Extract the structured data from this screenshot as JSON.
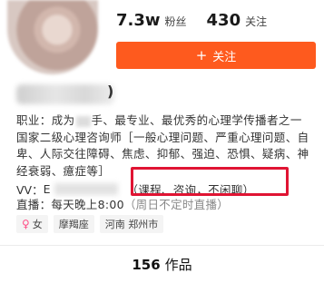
{
  "stats": {
    "fans_count": "7.3w",
    "fans_label": "粉丝",
    "following_count": "430",
    "following_label": "关注"
  },
  "follow_button": {
    "plus": "+",
    "label": "关注"
  },
  "profile": {
    "name_suffix": ")",
    "bio_line1_pre": "职业：成为",
    "bio_line1_post": "手、最专业、最优秀的心理学传播者之一",
    "bio_line2": "国家二级心理咨询师［一般心理问题、严重心理问题、自",
    "bio_line3": "卑、人际交往障碍、焦虑、抑郁、强迫、恐惧、疑病、神",
    "bio_line4": "经衰弱、癔症等］",
    "vv_label": "VV：",
    "vv_prefix": "E",
    "vv_note": "（课程、咨询，不闲聊）",
    "live_label": "直播：每天晚上8:00",
    "live_note": "（周日不定时直播）"
  },
  "tags": {
    "gender_icon": "female-icon",
    "gender": "女",
    "zodiac": "摩羯座",
    "location": "河南 郑州市"
  },
  "works": {
    "count": "156",
    "label": "作品"
  },
  "colors": {
    "accent": "#fe5a1e",
    "highlight": "#e01433",
    "female": "#ff4f86"
  }
}
